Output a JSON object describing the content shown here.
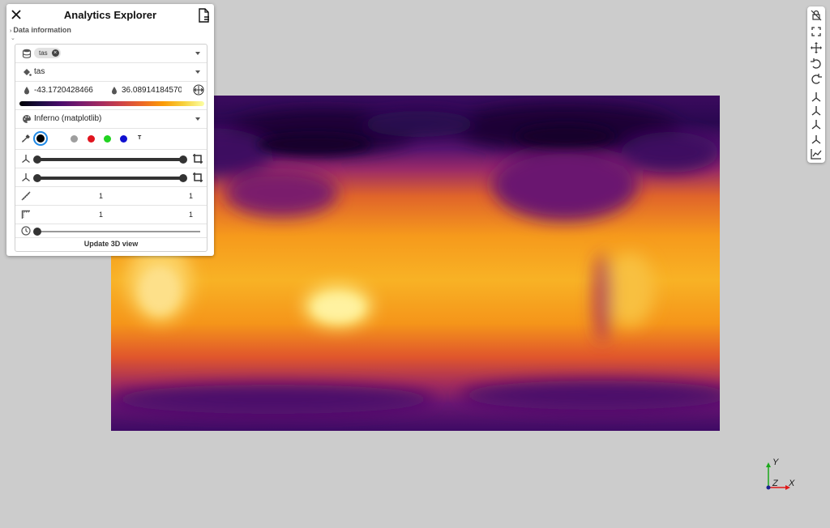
{
  "panel": {
    "title": "Analytics Explorer",
    "section_label": "Data information",
    "dataset_chip": "tas",
    "chip_close": "×",
    "variable": "tas",
    "range_min": "-43.1720428466",
    "range_max": "36.08914184570",
    "colormap": "Inferno (matplotlib)",
    "text_color_letter": "T",
    "slice_a_value_1": "1",
    "slice_a_value_2": "1",
    "slice_b_value_1": "1",
    "slice_b_value_2": "1",
    "update_button": "Update 3D view"
  },
  "swatches": {
    "colors": [
      "#000000",
      "#9e9e9e",
      "#e0141e",
      "#21d321",
      "#1010d0"
    ]
  },
  "icons": {
    "close": "close-icon",
    "export": "file-export-icon",
    "dataset": "database-icon",
    "variable": "paint-bucket-icon",
    "range_min": "drop-icon",
    "range_max": "drop-icon",
    "range_reset": "expand-arrows-icon",
    "colormap": "palette-icon",
    "picker": "eyedropper-icon",
    "axes": "axes-icon",
    "crop": "crop-icon",
    "scale": "ruler-icon",
    "time": "clock-icon",
    "toolbar": [
      "lock-off-icon",
      "fullscreen-icon",
      "move-icon",
      "rotate-left-icon",
      "rotate-right-icon",
      "axis-x-icon",
      "axis-y-icon",
      "axis-z-icon",
      "axis-reset-icon",
      "chart-icon"
    ]
  },
  "axes_widget": {
    "x": "X",
    "y": "Y",
    "z": "Z"
  },
  "colors": {
    "accent": "#1e88e5",
    "colormap_stops": [
      "#000004",
      "#1b0c41",
      "#4a0c6b",
      "#781c6d",
      "#a52c60",
      "#cf4446",
      "#ed6925",
      "#fb9b06",
      "#f7d13d",
      "#fcffa4"
    ]
  }
}
